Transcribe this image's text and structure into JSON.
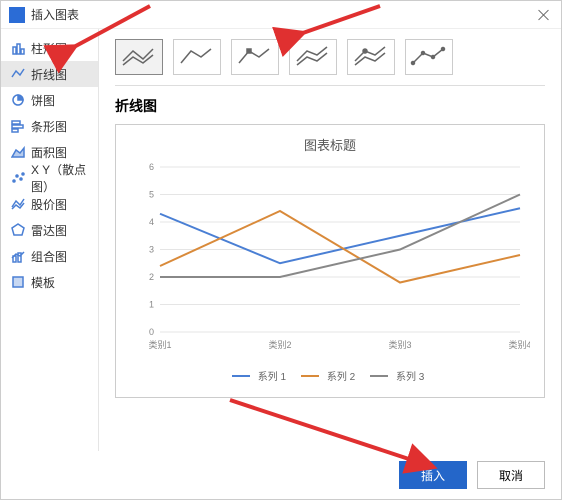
{
  "dialog": {
    "title": "插入图表"
  },
  "sidebar": {
    "items": [
      {
        "label": "柱形图",
        "icon": "column"
      },
      {
        "label": "折线图",
        "icon": "line",
        "active": true
      },
      {
        "label": "饼图",
        "icon": "pie"
      },
      {
        "label": "条形图",
        "icon": "bar"
      },
      {
        "label": "面积图",
        "icon": "area"
      },
      {
        "label": "X Y（散点图）",
        "icon": "scatter"
      },
      {
        "label": "股价图",
        "icon": "stock"
      },
      {
        "label": "雷达图",
        "icon": "radar"
      },
      {
        "label": "组合图",
        "icon": "combo"
      },
      {
        "label": "模板",
        "icon": "template"
      }
    ]
  },
  "section_title": "折线图",
  "chart_title": "图表标题",
  "buttons": {
    "insert": "插入",
    "cancel": "取消"
  },
  "legend": {
    "s1": "系列 1",
    "s2": "系列 2",
    "s3": "系列 3"
  },
  "chart_data": {
    "type": "line",
    "title": "图表标题",
    "xlabel": "",
    "ylabel": "",
    "ylim": [
      0,
      6
    ],
    "categories": [
      "类别1",
      "类别2",
      "类别3",
      "类别4"
    ],
    "series": [
      {
        "name": "系列 1",
        "color": "#4a7fd4",
        "values": [
          4.3,
          2.5,
          3.5,
          4.5
        ]
      },
      {
        "name": "系列 2",
        "color": "#d98a3a",
        "values": [
          2.4,
          4.4,
          1.8,
          2.8
        ]
      },
      {
        "name": "系列 3",
        "color": "#888888",
        "values": [
          2.0,
          2.0,
          3.0,
          5.0
        ]
      }
    ]
  }
}
